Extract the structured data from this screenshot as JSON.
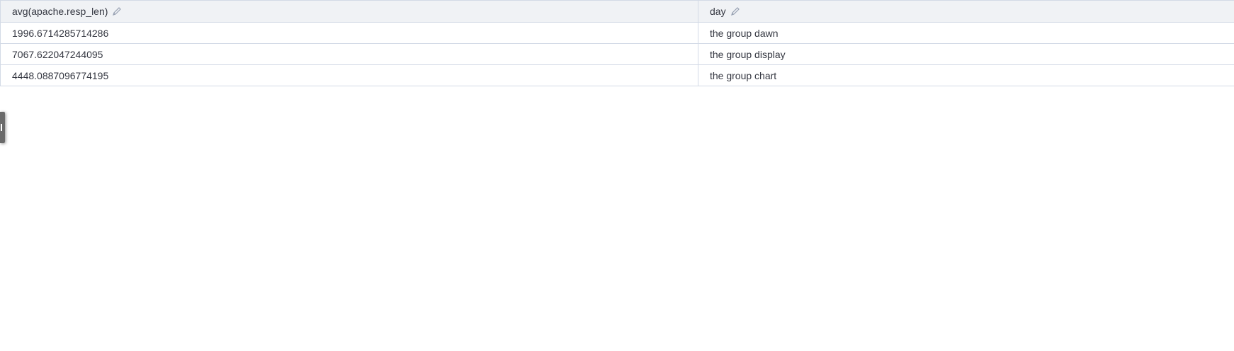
{
  "table": {
    "columns": [
      {
        "label": "avg(apache.resp_len)",
        "icon": "pencil-icon"
      },
      {
        "label": "day",
        "icon": "pencil-icon"
      }
    ],
    "rows": [
      [
        "1996.6714285714286",
        "the group dawn"
      ],
      [
        "7067.622047244095",
        "the group display"
      ],
      [
        "4448.0887096774195",
        "the group chart"
      ]
    ]
  },
  "colors": {
    "header_bg": "#f0f2f5",
    "border": "#d3dae6",
    "text": "#343741",
    "icon": "#98a2b3"
  }
}
